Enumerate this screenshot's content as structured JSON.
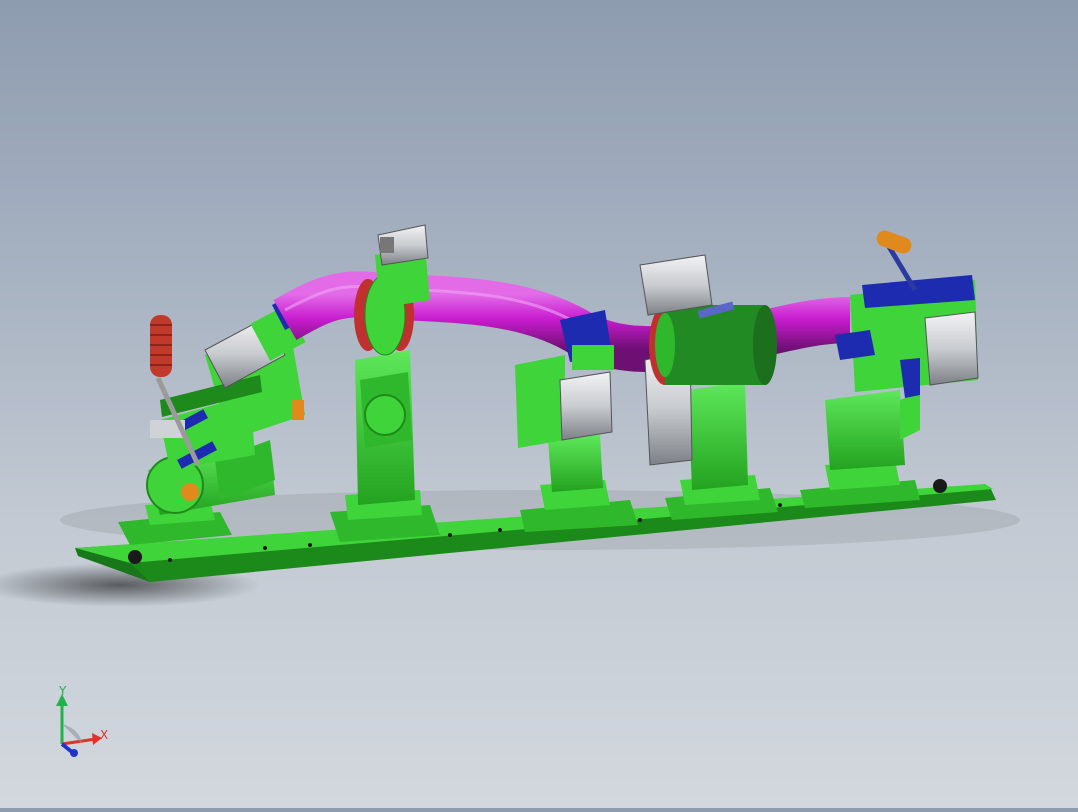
{
  "viewport": {
    "description_free": true,
    "colors": {
      "fixture": "#3fd43a",
      "fixture_dark": "#1f8a1c",
      "tube": "#c81ccf",
      "tube_dark": "#7c1482",
      "clamp_blue": "#1c2bb0",
      "cylinder": "#d8dadc",
      "handle_red": "#c0392b",
      "handle_orange": "#e08a1e",
      "flange": "#c0302e"
    }
  },
  "triad": {
    "x_label": "X",
    "y_label": "Y",
    "x_color": "#e0312a",
    "y_color": "#22b24a",
    "z_color": "#2233c8"
  }
}
